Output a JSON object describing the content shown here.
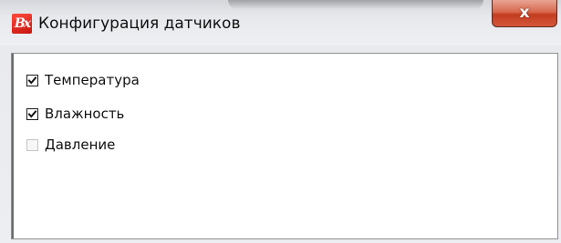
{
  "window": {
    "title": "Конфигурация датчиков",
    "icon": "bx-app-icon",
    "icon_text": "Bx",
    "close_glyph": "x"
  },
  "sensors": [
    {
      "label": "Температура",
      "checked": true
    },
    {
      "label": "Влажность",
      "checked": true
    },
    {
      "label": "Давление",
      "checked": false
    }
  ],
  "colors": {
    "close_button": "#d4563a",
    "app_icon": "#d81e12",
    "panel_border": "#8e8f8f"
  }
}
